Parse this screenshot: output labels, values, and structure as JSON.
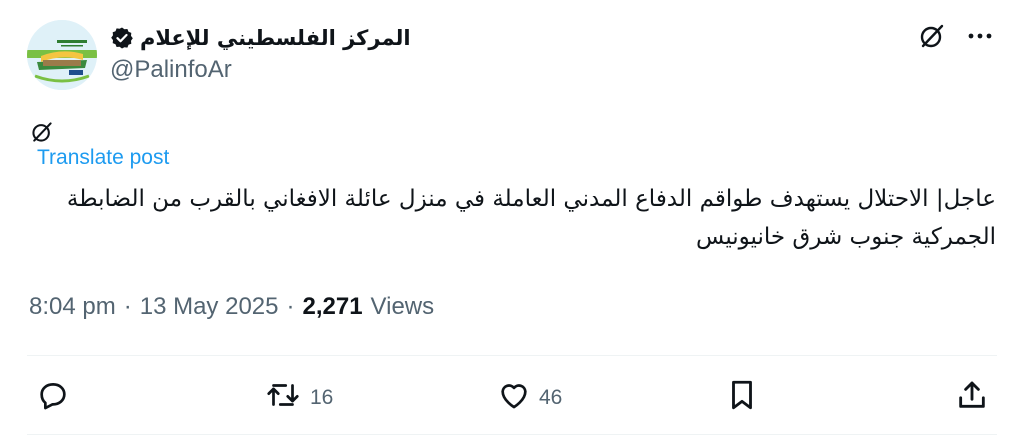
{
  "account": {
    "display_name": "المركز الفلسطيني للإعلام",
    "handle": "@PalinfoAr",
    "verified": true
  },
  "post": {
    "translate_label": "Translate post",
    "text": "عاجل| الاحتلال يستهدف طواقم الدفاع المدني العاملة في منزل عائلة الافغاني بالقرب من الضابطة الجمركية جنوب شرق خانيونيس",
    "time": "8:04 pm",
    "separator": "·",
    "date": "13 May 2025",
    "views_count": "2,271",
    "views_label": "Views"
  },
  "actions": {
    "reposts": "16",
    "likes": "46"
  },
  "icons": [
    "grok-icon",
    "more-icon",
    "verified-badge-icon",
    "reply-icon",
    "repost-icon",
    "like-icon",
    "bookmark-icon",
    "share-icon"
  ],
  "colors": {
    "link": "#1d9bf0",
    "muted": "#536471",
    "text": "#0f1419"
  }
}
